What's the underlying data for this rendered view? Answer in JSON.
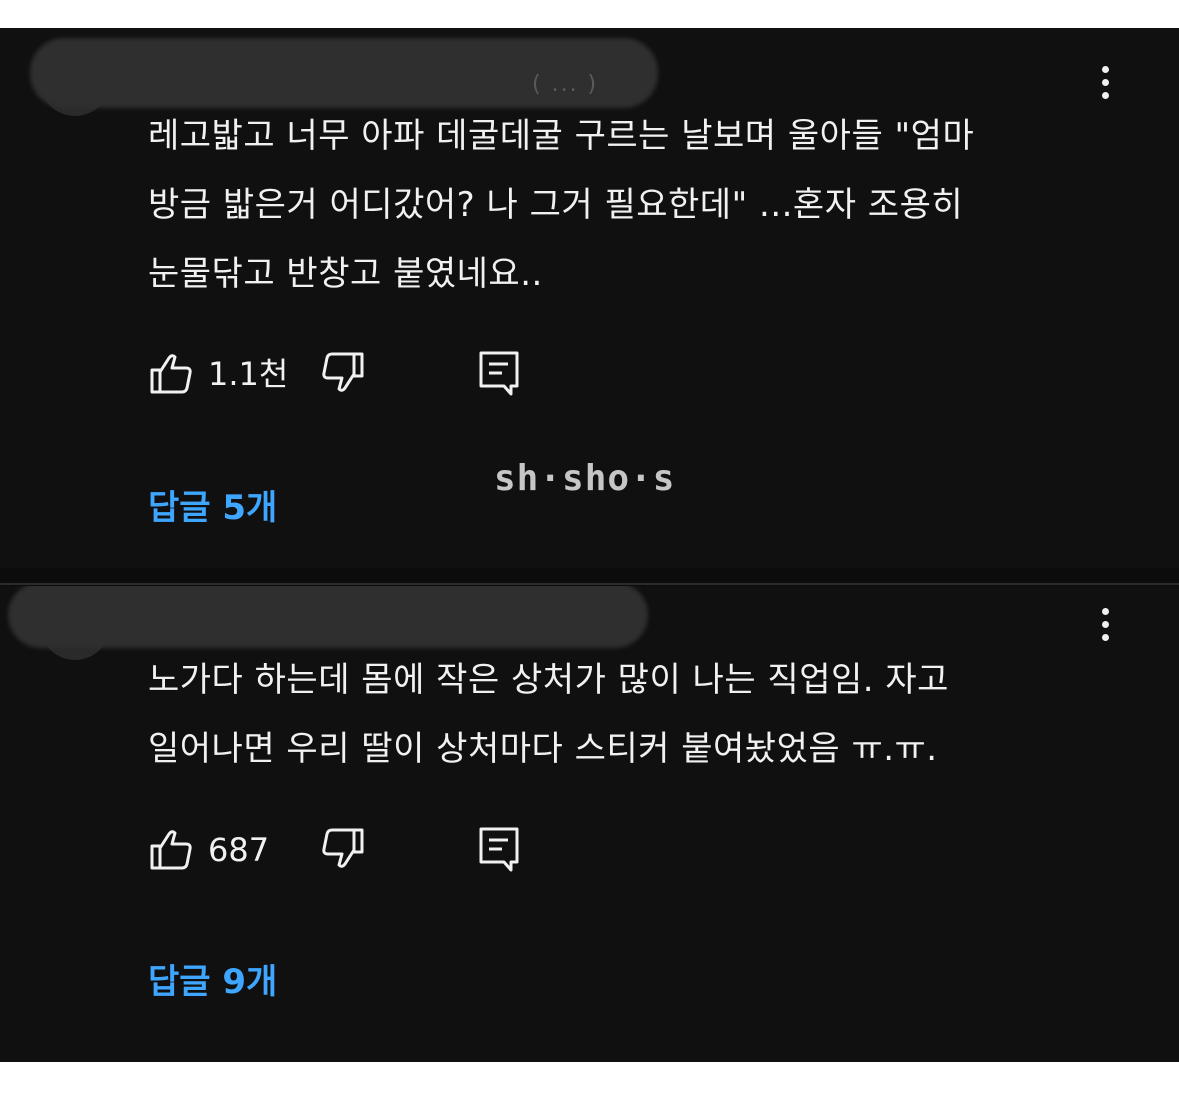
{
  "comments": [
    {
      "author_fragment": "(   ...  )",
      "text": "레고밟고 너무 아파 데굴데굴 구르는 날보며 울아들 \"엄마\n방금 밟은거 어디갔어? 나 그거 필요한데\" ...혼자 조용히\n눈물닦고 반창고 붙였네요..",
      "likes": "1.1천",
      "replies_label": "답글 5개"
    },
    {
      "text": "노가다 하는데 몸에 작은 상처가 많이 나는 직업임. 자고\n일어나면 우리 딸이 상처마다 스티커 붙여놨었음 ㅠ.ㅠ.",
      "likes": "687",
      "replies_label": "답글 9개"
    }
  ],
  "watermark": "sh·sho·s",
  "colors": {
    "background": "#101010",
    "text": "#f1f1f1",
    "link": "#3ea6ff"
  },
  "icons": [
    "like-icon",
    "dislike-icon",
    "reply-icon",
    "more-options-icon"
  ]
}
